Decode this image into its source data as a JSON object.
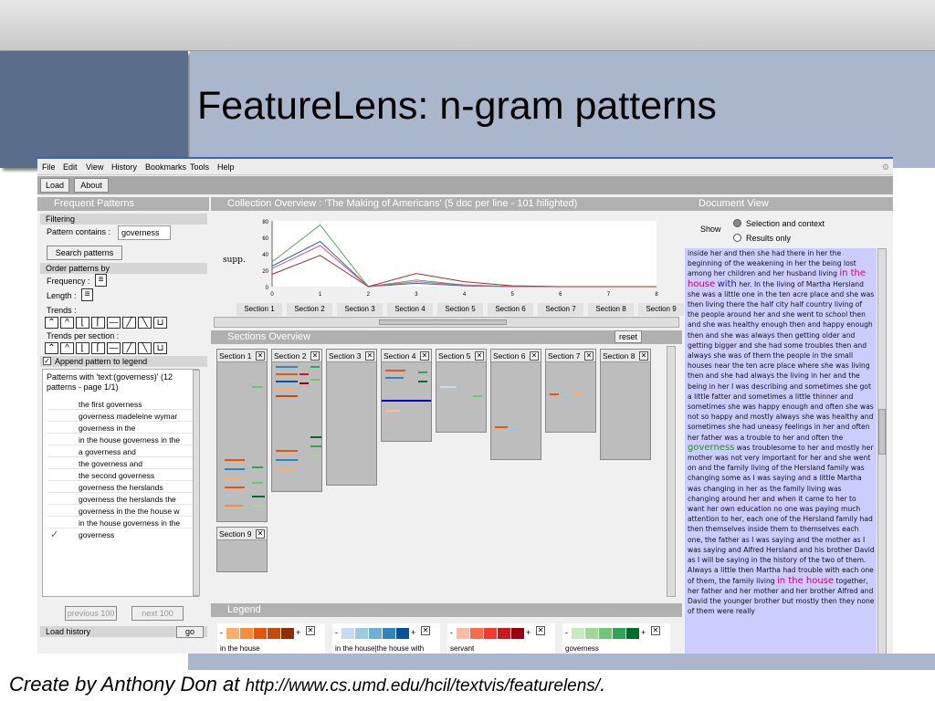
{
  "slide": {
    "title": "FeatureLens: n-gram patterns",
    "footer_prefix": "Create by Anthony Don at ",
    "footer_url": "http://www.cs.umd.edu/hcil/textvis/featurelens/",
    "footer_suffix": "."
  },
  "menu": [
    "File",
    "Edit",
    "View",
    "History",
    "Bookmarks",
    "Tools",
    "Help"
  ],
  "toolbar": {
    "load": "Load",
    "about": "About"
  },
  "frequent": {
    "header": "Frequent Patterns",
    "filtering": "Filtering",
    "contains_label": "Pattern contains :",
    "contains_value": "governess",
    "search_btn": "Search patterns",
    "order_by": "Order patterns by",
    "frequency": "Frequency :",
    "length": "Length :",
    "trends": "Trends :",
    "trends_per_section": "Trends per section :",
    "append": "Append pattern to legend",
    "list_header": "Patterns with 'text:(governess)' (12 patterns - page 1/1)",
    "patterns": [
      "the first governess",
      "governess madeleine wymar",
      "governess in the",
      "in the house governess in the",
      "a governess and",
      "the governess and",
      "the second governess",
      "governess the herslands",
      "governess the herslands the",
      "governess in the the house w",
      "in the house governess in the",
      "governess"
    ],
    "prev_btn": "previous 100",
    "next_btn": "next 100",
    "load_history": "Load history",
    "go_btn": "go"
  },
  "overview": {
    "header": "Collection Overview : 'The Making of Americans' (5 doc per line - 101 hilighted)",
    "sections_header": "Sections Overview",
    "reset_btn": "reset",
    "section_tabs": [
      "Section 1",
      "Section 2",
      "Section 3",
      "Section 4",
      "Section 5",
      "Section 6",
      "Section 7",
      "Section 8",
      "Section 9"
    ],
    "section_boxes": [
      "Section 1",
      "Section 2",
      "Section 3",
      "Section 4",
      "Section 5",
      "Section 6",
      "Section 7",
      "Section 8",
      "Section 9"
    ]
  },
  "chart_data": {
    "type": "line",
    "ylabel": "supp.",
    "x": [
      0,
      1,
      2,
      3,
      4,
      5,
      6,
      7,
      8
    ],
    "ylim": [
      0,
      80
    ],
    "yticks": [
      0,
      20,
      40,
      60,
      80
    ],
    "series": [
      {
        "color": "#5aa55a",
        "values": [
          30,
          75,
          0,
          8,
          2,
          0,
          0,
          0,
          0
        ]
      },
      {
        "color": "#3a5faa",
        "values": [
          25,
          55,
          0,
          4,
          1,
          0,
          0,
          0,
          0
        ]
      },
      {
        "color": "#c85a8a",
        "values": [
          22,
          50,
          0,
          6,
          2,
          0,
          0,
          0,
          0
        ]
      },
      {
        "color": "#a03030",
        "values": [
          15,
          38,
          0,
          16,
          6,
          1,
          0,
          0,
          0
        ]
      }
    ]
  },
  "legend": {
    "header": "Legend",
    "items": [
      {
        "label": "in the house",
        "colors": [
          "#fdae6b",
          "#f88d3a",
          "#e6550d",
          "#c74a0d",
          "#8c2d04"
        ]
      },
      {
        "label": "in the house|the house with",
        "colors": [
          "#c6dbef",
          "#9ecae1",
          "#6baed6",
          "#3182bd",
          "#08519c"
        ]
      },
      {
        "label": "servant",
        "colors": [
          "#fcbba1",
          "#fb6a4a",
          "#ef3b2c",
          "#cb181d",
          "#99000d"
        ]
      },
      {
        "label": "governess",
        "colors": [
          "#c7e9c0",
          "#a1d99b",
          "#74c476",
          "#31a354",
          "#006d2c"
        ]
      }
    ]
  },
  "document": {
    "header": "Document View",
    "show": "Show",
    "opt1": "Selection and context",
    "opt2": "Results only",
    "text": [
      {
        "t": "inside her and then she had there in her the beginning of the weakening in her the being lost among her children and her husband living "
      },
      {
        "t": "in the house",
        "c": "hl"
      },
      {
        "t": " "
      },
      {
        "t": "with",
        "c": "hl2"
      },
      {
        "t": " her. In the living of Martha Hersland she was a little one in the ten acre place and she was then living there the half city half country living of the people around her and she went to school then and she was healthy enough then and happy enough then and she was always then getting older and getting bigger and she had some troubles then and always she was of them the people in the small houses near the ten acre place where she was living then and she had always the living in her and the being in her I was describing and sometimes she got a little fatter and sometimes a little thinner and sometimes she was happy enough and often she was not so happy and mostly always she was healthy and sometimes she had uneasy feelings in her and often her father was a trouble to her and often the "
      },
      {
        "t": "governess",
        "c": "hl3"
      },
      {
        "t": " was troublesome to her and mostly her mother was not very important for her and she went on and the family living of the Hersland family was changing some as I was saying and a little Martha was changing in her as the family living was changing around her and when it came to her to want her own education no one was paying much attention to her, each one of the Hersland family had then themselves inside them to themselves each one, the father as I was saying and the mother as I was saying and Alfred Hersland and his brother David as I will be saying in the history of the two of them. Always a little then Martha had trouble with each one of them, the family living "
      },
      {
        "t": "in the house",
        "c": "hl"
      },
      {
        "t": " together, her father and her mother and her brother Alfred and David the younger brother but mostly then they none of them were really"
      }
    ]
  },
  "colors": {
    "accent": "#3a5fcd",
    "panel_header": "#b0b0b0",
    "doc_bg": "#ccccff"
  }
}
